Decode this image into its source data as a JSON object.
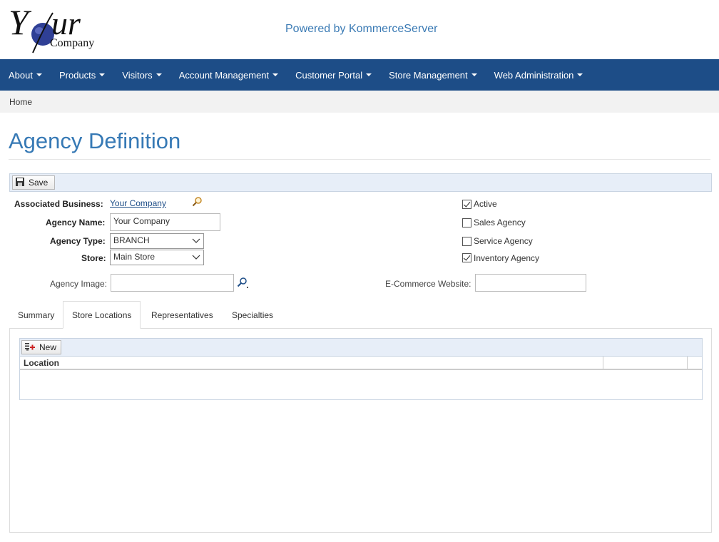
{
  "header": {
    "logo": {
      "big_y": "Y",
      "big_ur": "ur",
      "company": "Company"
    },
    "powered_by": "Powered by KommerceServer"
  },
  "nav": {
    "items": [
      {
        "label": "About"
      },
      {
        "label": "Products"
      },
      {
        "label": "Visitors"
      },
      {
        "label": "Account Management"
      },
      {
        "label": "Customer Portal"
      },
      {
        "label": "Store Management"
      },
      {
        "label": "Web Administration"
      }
    ]
  },
  "breadcrumb": {
    "home": "Home"
  },
  "page": {
    "title": "Agency Definition"
  },
  "toolbar": {
    "save_label": "Save"
  },
  "form": {
    "associated_business_label": "Associated Business:",
    "associated_business_value": "Your Company",
    "agency_name_label": "Agency Name:",
    "agency_name_value": "Your Company",
    "agency_type_label": "Agency Type:",
    "agency_type_value": "BRANCH",
    "store_label": "Store:",
    "store_value": "Main Store",
    "agency_image_label": "Agency Image:",
    "agency_image_value": "",
    "ecommerce_label": "E-Commerce Website:",
    "ecommerce_value": ""
  },
  "flags": {
    "active": {
      "label": "Active",
      "checked": true
    },
    "sales": {
      "label": "Sales Agency",
      "checked": false
    },
    "service": {
      "label": "Service Agency",
      "checked": false
    },
    "inventory": {
      "label": "Inventory Agency",
      "checked": true
    }
  },
  "tabs": [
    {
      "label": "Summary"
    },
    {
      "label": "Store Locations",
      "active": true
    },
    {
      "label": "Representatives"
    },
    {
      "label": "Specialties"
    }
  ],
  "grid": {
    "new_label": "New",
    "columns": [
      "Location",
      "",
      ""
    ]
  },
  "colors": {
    "navbar": "#1d4d87",
    "title": "#3679b5",
    "toolbar": "#e7eef8"
  }
}
